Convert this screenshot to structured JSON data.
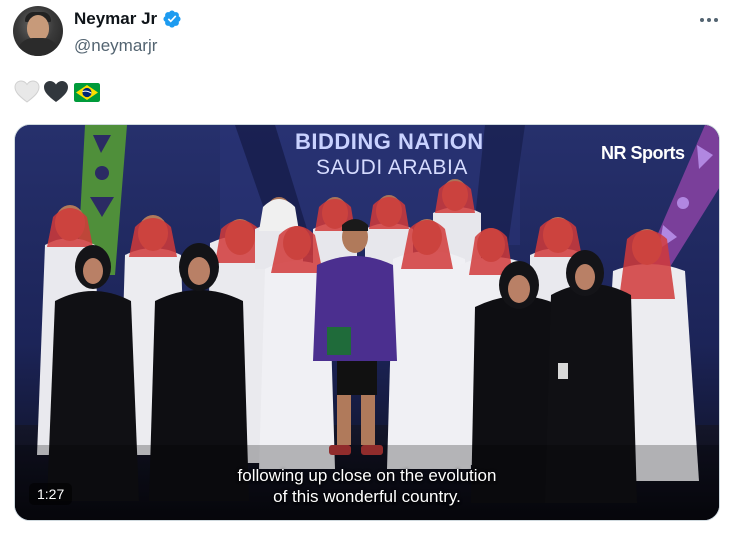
{
  "tweet": {
    "author": {
      "display_name": "Neymar Jr",
      "handle": "@neymarjr",
      "verified_icon": "verified-badge-icon",
      "verified_color": "#1d9bf0"
    },
    "more_icon": "more-horizontal-icon",
    "text_emojis": [
      "white-heart",
      "black-heart",
      "brazil-flag"
    ],
    "media": {
      "type": "video",
      "banner_title": "BIDDING NATION",
      "banner_subtitle": "SAUDI ARABIA",
      "watermark": "NR Sports",
      "caption_line1": "following up close on the evolution",
      "caption_line2": "of this wonderful country.",
      "duration": "1:27"
    }
  },
  "colors": {
    "text_primary": "#0f1419",
    "text_secondary": "#536471",
    "stage_background": "#1b2354"
  }
}
